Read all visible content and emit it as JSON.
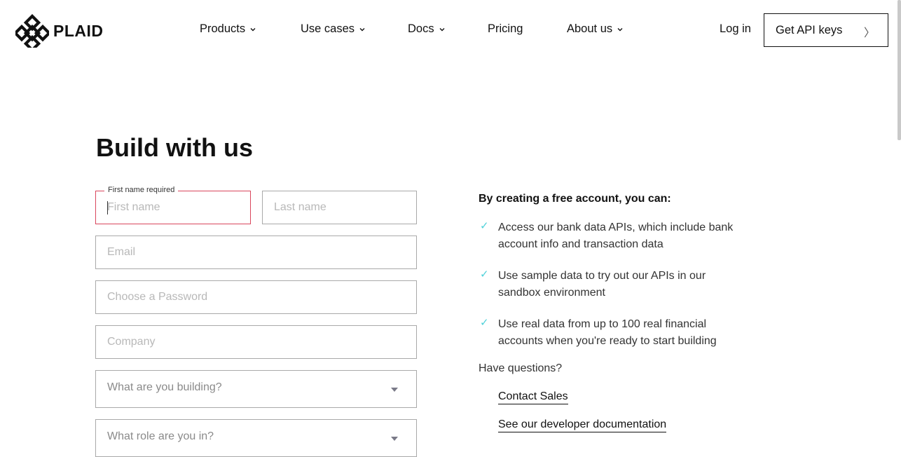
{
  "brand": {
    "name": "PLAID",
    "logo_icon": "plaid-logo-icon"
  },
  "nav": {
    "items": [
      {
        "label": "Products",
        "has_dropdown": true
      },
      {
        "label": "Use cases",
        "has_dropdown": true
      },
      {
        "label": "Docs",
        "has_dropdown": true
      },
      {
        "label": "Pricing",
        "has_dropdown": false
      },
      {
        "label": "About us",
        "has_dropdown": true
      }
    ],
    "login_label": "Log in",
    "api_button_label": "Get API keys",
    "api_button_icon": "chevron-right-icon"
  },
  "page": {
    "title": "Build with us"
  },
  "form": {
    "first_name": {
      "label": "First name required",
      "placeholder": "First name",
      "value": ""
    },
    "last_name": {
      "placeholder": "Last name",
      "value": ""
    },
    "email": {
      "placeholder": "Email",
      "value": ""
    },
    "password": {
      "placeholder": "Choose a Password",
      "value": ""
    },
    "company": {
      "placeholder": "Company",
      "value": ""
    },
    "building": {
      "placeholder": "What are you building?"
    },
    "role": {
      "placeholder": "What role are you in?"
    }
  },
  "info": {
    "heading": "By creating a free account, you can:",
    "benefits": [
      {
        "text": "Access our bank data APIs, which include bank account info and transaction data"
      },
      {
        "text": "Use sample data to try out our APIs in our sandbox environment"
      },
      {
        "text": "Use real data from up to 100 real financial accounts when you're ready to start building"
      }
    ],
    "check_symbol": "✓",
    "questions": "Have questions?",
    "contact_sales": "Contact Sales",
    "developer_docs": "See our developer documentation"
  },
  "colors": {
    "accent_check": "#4fd1d9",
    "error_border": "#d9465c",
    "text": "#111111"
  }
}
